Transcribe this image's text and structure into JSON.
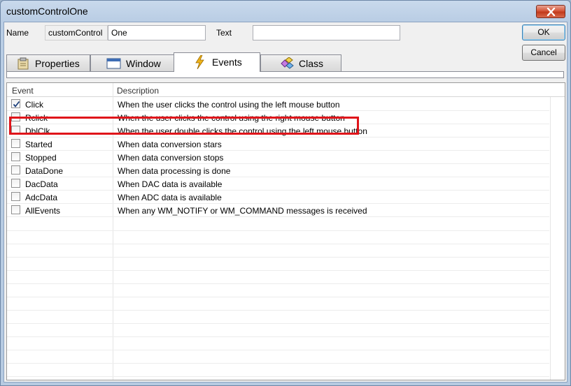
{
  "window": {
    "title": "customControlOne",
    "close_icon": "close-icon",
    "accent": "#c23a1c"
  },
  "form": {
    "name_label": "Name",
    "name_prefix": "customControl",
    "name_value": "One",
    "text_label": "Text",
    "text_value": ""
  },
  "buttons": {
    "ok": "OK",
    "cancel": "Cancel"
  },
  "tabs": [
    {
      "label": "Properties",
      "icon": "properties-icon",
      "active": false
    },
    {
      "label": "Window",
      "icon": "window-icon",
      "active": false
    },
    {
      "label": "Events",
      "icon": "lightning-icon",
      "active": true
    },
    {
      "label": "Class",
      "icon": "class-icon",
      "active": false
    }
  ],
  "grid": {
    "columns": [
      "Event",
      "Description"
    ],
    "rows": [
      {
        "name": "Click",
        "checked": true,
        "description": "When the user clicks the control using the left mouse button"
      },
      {
        "name": "Rclick",
        "checked": false,
        "description": "When the user clicks the control using the right mouse button"
      },
      {
        "name": "DblClk",
        "checked": false,
        "description": "When the user double clicks the control using the left mouse button"
      },
      {
        "name": "Started",
        "checked": false,
        "description": "When data conversion stars"
      },
      {
        "name": "Stopped",
        "checked": false,
        "description": "When data conversion stops"
      },
      {
        "name": "DataDone",
        "checked": false,
        "description": "When data processing is done"
      },
      {
        "name": "DacData",
        "checked": false,
        "description": "When DAC data is available"
      },
      {
        "name": "AdcData",
        "checked": false,
        "description": "When ADC data is available"
      },
      {
        "name": "AllEvents",
        "checked": false,
        "description": "When any WM_NOTIFY or WM_COMMAND messages is received"
      }
    ],
    "highlight_color": "#e0141a"
  }
}
